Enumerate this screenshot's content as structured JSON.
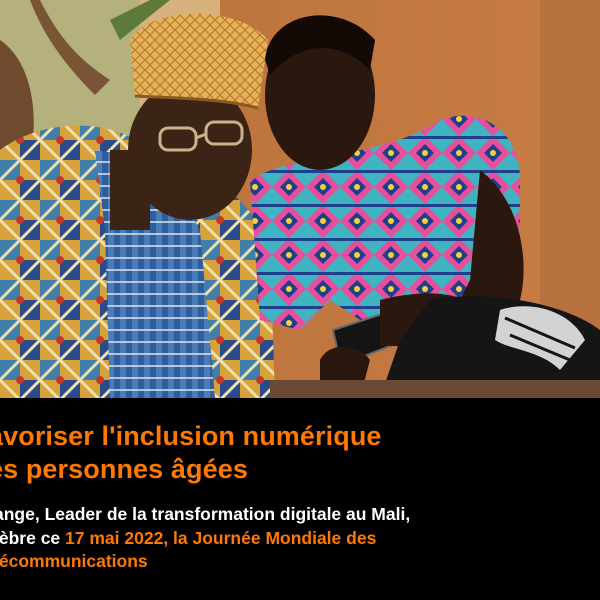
{
  "headline": {
    "line1": "avoriser l'inclusion numérique",
    "line2": "es personnes âgées"
  },
  "body": {
    "line1": "ange, Leader de la transformation digitale au Mali,",
    "line2_pre": "lèbre ce ",
    "line2_date": "17 mai 2022",
    "line2_sep": ", ",
    "line2_event": "la Journée Mondiale des",
    "line3": "lécommunications"
  },
  "colors": {
    "accent": "#ff7900",
    "background": "#000000",
    "text": "#ffffff"
  }
}
